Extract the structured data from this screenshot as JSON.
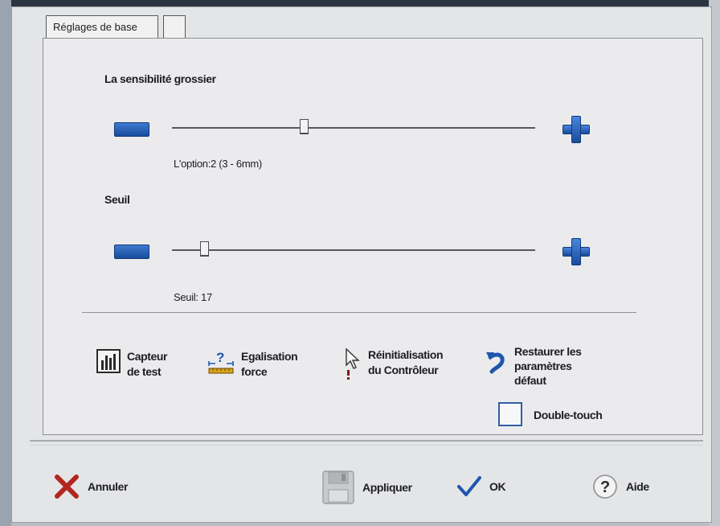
{
  "tabs": [
    {
      "label": "Réglages de base"
    },
    {
      "label": ""
    }
  ],
  "sensitivity": {
    "title": "La sensibilité grossier",
    "caption": "L'option:2 (3 - 6mm)",
    "level": 0.36
  },
  "threshold": {
    "title": "Seuil",
    "caption": "Seuil: 17",
    "level": 0.08
  },
  "tools": [
    {
      "line1": "Capteur",
      "line2": "de test",
      "icon": "bar-chart-icon"
    },
    {
      "line1": "Egalisation",
      "line2": "force",
      "icon": "ruler-question-icon"
    },
    {
      "line1": "Réinitialisation",
      "line2": "du Contrôleur",
      "icon": "cursor-alert-icon"
    },
    {
      "line1": "Restaurer les",
      "line2": "paramètres",
      "line3": "défaut",
      "icon": "undo-arrow-icon"
    }
  ],
  "double_touch": {
    "label": "Double-touch",
    "checked": false
  },
  "footer": {
    "cancel": "Annuler",
    "apply": "Appliquer",
    "ok": "OK",
    "help": "Aide"
  },
  "colors": {
    "accent_blue": "#1f56ad",
    "cancel_red": "#b3261e",
    "panel_bg": "#ebebed"
  }
}
